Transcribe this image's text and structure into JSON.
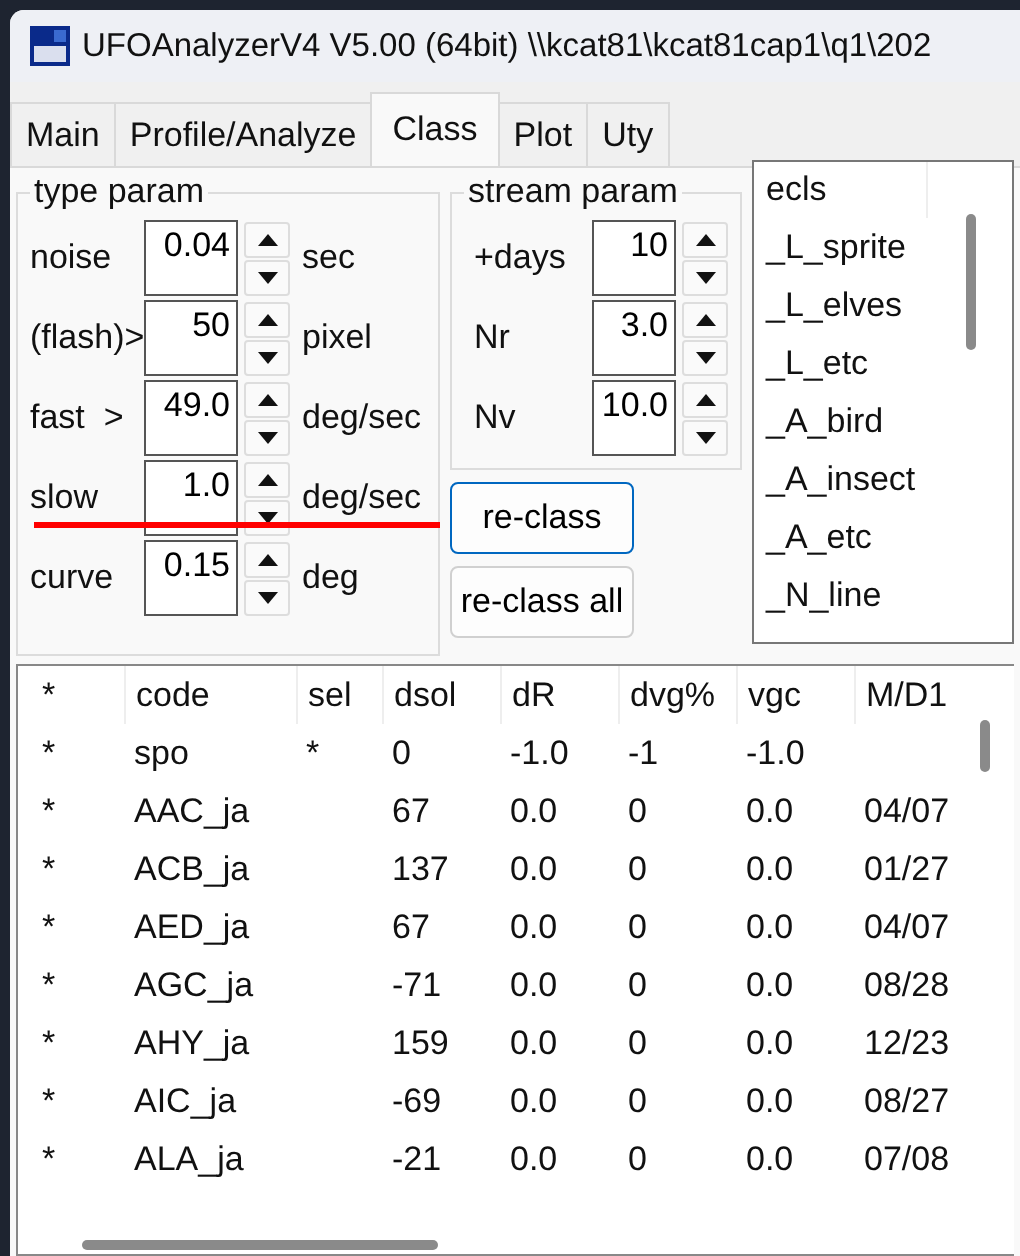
{
  "window": {
    "title": "UFOAnalyzerV4 V5.00 (64bit) \\\\kcat81\\kcat81cap1\\q1\\202"
  },
  "tabs": [
    {
      "label": "Main",
      "selected": false
    },
    {
      "label": "Profile/Analyze",
      "selected": false
    },
    {
      "label": "Class",
      "selected": true
    },
    {
      "label": "Plot",
      "selected": false
    },
    {
      "label": "Uty",
      "selected": false
    }
  ],
  "type_param": {
    "title": "type param",
    "fields": [
      {
        "label": "noise",
        "value": "0.04",
        "unit": "sec"
      },
      {
        "label": "(flash)>",
        "value": "50",
        "unit": "pixel"
      },
      {
        "label": "fast  >",
        "value": "49.0",
        "unit": "deg/sec"
      },
      {
        "label": "slow",
        "value": "1.0",
        "unit": "deg/sec"
      },
      {
        "label": "curve",
        "value": "0.15",
        "unit": "deg"
      }
    ]
  },
  "stream_param": {
    "title": "stream param",
    "fields": [
      {
        "label": "+days",
        "value": "10"
      },
      {
        "label": "Nr",
        "value": "3.0"
      },
      {
        "label": "Nv",
        "value": "10.0"
      }
    ]
  },
  "buttons": [
    {
      "label": "re-class",
      "focused": true
    },
    {
      "label": "re-class all",
      "focused": false
    }
  ],
  "class_list": {
    "header": "ecls",
    "items": [
      "_L_sprite",
      "_L_elves",
      "_L_etc",
      "_A_bird",
      "_A_insect",
      "_A_etc",
      "_N_line"
    ]
  },
  "table": {
    "columns": [
      "*",
      "code",
      "sel",
      "dsol",
      "dR",
      "dvg%",
      "vgc",
      "M/D1"
    ],
    "rows": [
      [
        "*",
        "spo",
        "*",
        "0",
        "-1.0",
        "-1",
        "-1.0",
        null
      ],
      [
        "*",
        "AAC_ja",
        null,
        "67",
        "0.0",
        "0",
        "0.0",
        "04/07"
      ],
      [
        "*",
        "ACB_ja",
        null,
        "137",
        "0.0",
        "0",
        "0.0",
        "01/27"
      ],
      [
        "*",
        "AED_ja",
        null,
        "67",
        "0.0",
        "0",
        "0.0",
        "04/07"
      ],
      [
        "*",
        "AGC_ja",
        null,
        "-71",
        "0.0",
        "0",
        "0.0",
        "08/28"
      ],
      [
        "*",
        "AHY_ja",
        null,
        "159",
        "0.0",
        "0",
        "0.0",
        "12/23"
      ],
      [
        "*",
        "AIC_ja",
        null,
        "-69",
        "0.0",
        "0",
        "0.0",
        "08/27"
      ],
      [
        "*",
        "ALA_ja",
        null,
        "-21",
        "0.0",
        "0",
        "0.0",
        "07/08"
      ]
    ]
  }
}
